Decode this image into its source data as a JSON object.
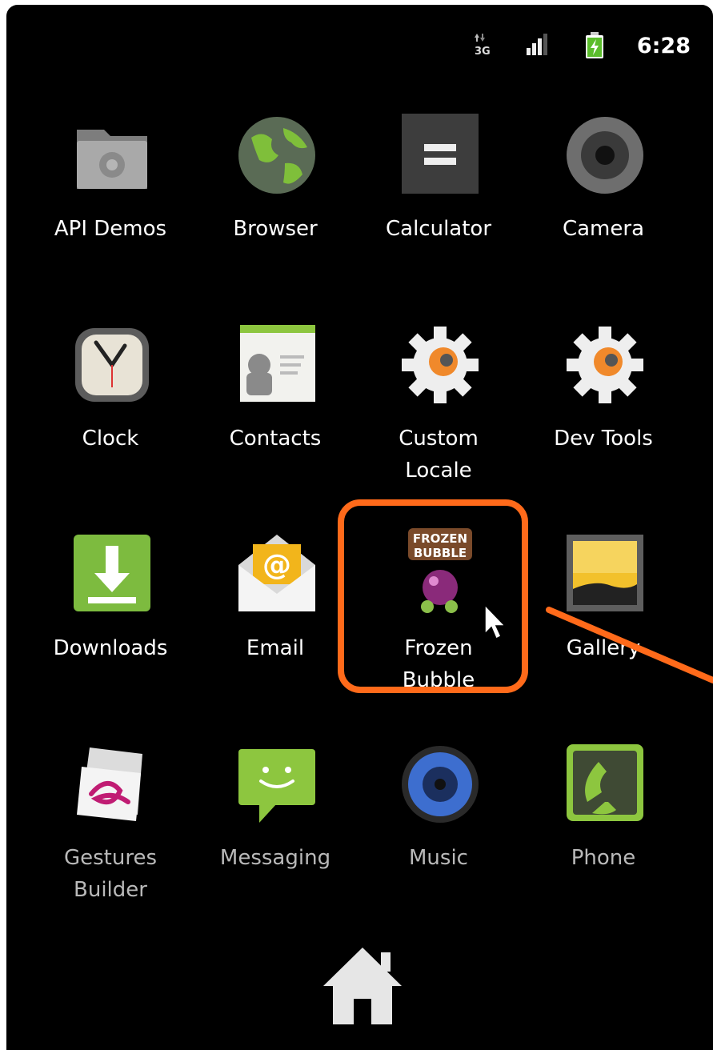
{
  "status_bar": {
    "time": "6:28",
    "network": "3G",
    "icons": [
      "data-arrows-3g-icon",
      "signal-bars-icon",
      "battery-charging-icon"
    ]
  },
  "apps": [
    {
      "label": "API Demos",
      "icon": "folder-gear-icon"
    },
    {
      "label": "Browser",
      "icon": "globe-icon"
    },
    {
      "label": "Calculator",
      "icon": "calculator-icon"
    },
    {
      "label": "Camera",
      "icon": "camera-lens-icon"
    },
    {
      "label": "Clock",
      "icon": "clock-icon"
    },
    {
      "label": "Contacts",
      "icon": "contacts-book-icon"
    },
    {
      "label_lines": [
        "Custom",
        "Locale"
      ],
      "icon": "gear-icon"
    },
    {
      "label": "Dev Tools",
      "icon": "gear-icon"
    },
    {
      "label": "Downloads",
      "icon": "download-arrow-icon"
    },
    {
      "label": "Email",
      "icon": "envelope-at-icon"
    },
    {
      "label_lines": [
        "Frozen",
        "Bubble"
      ],
      "icon": "frozen-bubble-icon"
    },
    {
      "label": "Gallery",
      "icon": "picture-frame-icon"
    },
    {
      "label_lines": [
        "Gestures",
        "Builder"
      ],
      "icon": "gestures-pad-icon"
    },
    {
      "label": "Messaging",
      "icon": "chat-bubble-icon"
    },
    {
      "label": "Music",
      "icon": "speaker-icon"
    },
    {
      "label": "Phone",
      "icon": "phone-handset-icon"
    }
  ],
  "highlighted_app": "Frozen Bubble",
  "frozen_bubble_logo_text": "FROZEN BUBBLE",
  "colors": {
    "highlight": "#ff6a1a",
    "background": "#000000",
    "label_text": "#ffffff"
  },
  "home_button": {
    "icon": "home-icon"
  }
}
